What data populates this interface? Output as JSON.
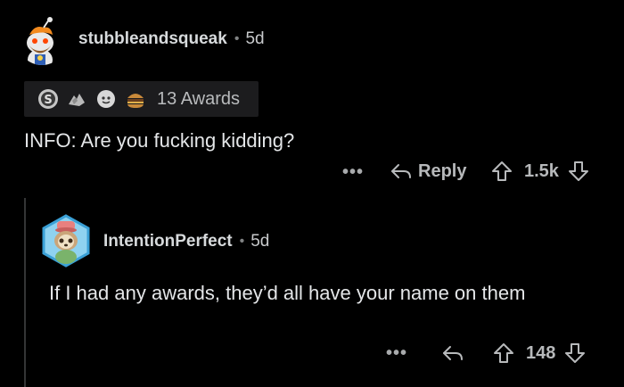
{
  "comments": [
    {
      "username": "stubbleandsqueak",
      "separator": "•",
      "age": "5d",
      "awards_label": "13 Awards",
      "body": "INFO: Are you fucking kidding?",
      "more_label": "•••",
      "reply_label": "Reply",
      "score": "1.5k"
    },
    {
      "username": "IntentionPerfect",
      "separator": "•",
      "age": "5d",
      "body": "If I had any awards, they’d all have your name on them",
      "more_label": "•••",
      "score": "148"
    }
  ],
  "colors": {
    "background": "#000000",
    "text_primary": "#d7dadc",
    "text_secondary": "#b7b9bb",
    "awards_bg": "#1c1c1e",
    "thread_line": "#343536"
  },
  "icons": {
    "award_1": "silver-s-award-icon",
    "award_2": "wholesome-hands-award-icon",
    "award_3": "face-award-icon",
    "award_4": "burger-award-icon",
    "reply": "reply-arrow-icon",
    "upvote": "upvote-arrow-icon",
    "downvote": "downvote-arrow-icon"
  }
}
